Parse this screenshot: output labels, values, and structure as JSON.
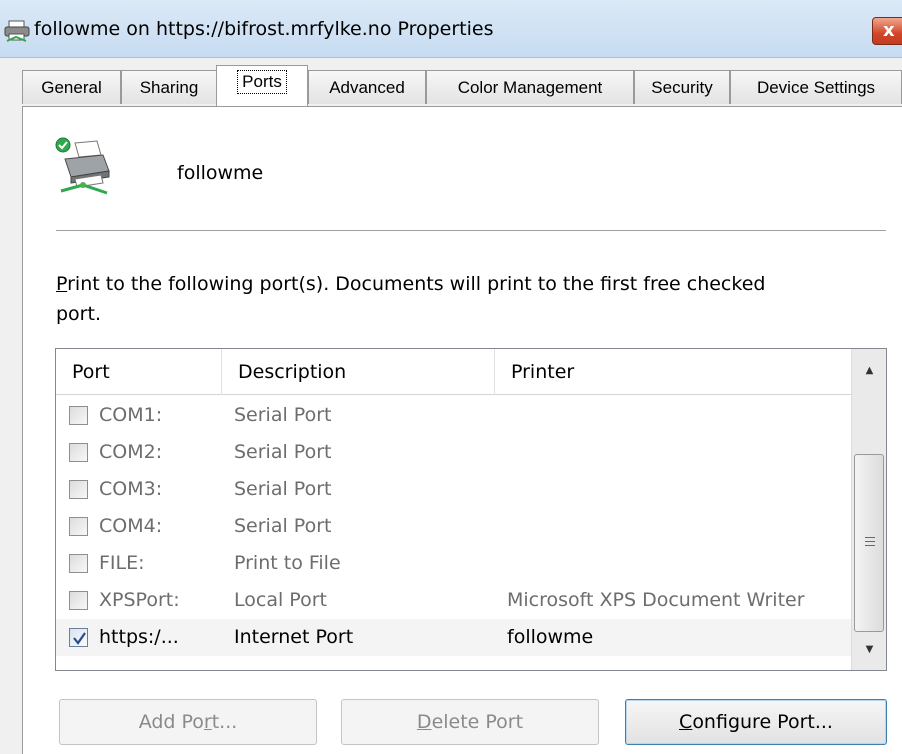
{
  "window": {
    "title": "followme on https://bifrost.mrfylke.no Properties",
    "close_glyph": "x",
    "icon": "printer-icon"
  },
  "tabs": [
    {
      "label": "General",
      "active": false
    },
    {
      "label": "Sharing",
      "active": false
    },
    {
      "label": "Ports",
      "active": true
    },
    {
      "label": "Advanced",
      "active": false
    },
    {
      "label": "Color Management",
      "active": false
    },
    {
      "label": "Security",
      "active": false
    },
    {
      "label": "Device Settings",
      "active": false
    }
  ],
  "printer": {
    "name": "followme",
    "icon": "networked-printer-default-icon"
  },
  "instructions": {
    "accel": "P",
    "rest": "rint to the following port(s). Documents will print to the first free checked port."
  },
  "port_list": {
    "columns": [
      "Port",
      "Description",
      "Printer"
    ],
    "rows": [
      {
        "port": "COM1:",
        "description": "Serial Port",
        "printer": "",
        "checked": false,
        "enabled": false
      },
      {
        "port": "COM2:",
        "description": "Serial Port",
        "printer": "",
        "checked": false,
        "enabled": false
      },
      {
        "port": "COM3:",
        "description": "Serial Port",
        "printer": "",
        "checked": false,
        "enabled": false
      },
      {
        "port": "COM4:",
        "description": "Serial Port",
        "printer": "",
        "checked": false,
        "enabled": false
      },
      {
        "port": "FILE:",
        "description": "Print to File",
        "printer": "",
        "checked": false,
        "enabled": false
      },
      {
        "port": "XPSPort:",
        "description": "Local Port",
        "printer": "Microsoft XPS Document Writer",
        "checked": false,
        "enabled": false
      },
      {
        "port": "https:/...",
        "description": "Internet Port",
        "printer": "followme",
        "checked": true,
        "enabled": true
      }
    ]
  },
  "buttons": {
    "add_port": {
      "pre": "Add Po",
      "accel": "r",
      "post": "t...",
      "enabled": false
    },
    "delete_port": {
      "pre": "",
      "accel": "D",
      "post": "elete Port",
      "enabled": false
    },
    "configure_port": {
      "pre": "",
      "accel": "C",
      "post": "onfigure Port...",
      "enabled": true
    }
  },
  "colors": {
    "titlebar": "#c7dcf1",
    "close_button": "#d2462a",
    "disabled_text": "#6d6d6d",
    "checkmark": "#2a4b8d",
    "status_ok": "#2fa84f"
  }
}
